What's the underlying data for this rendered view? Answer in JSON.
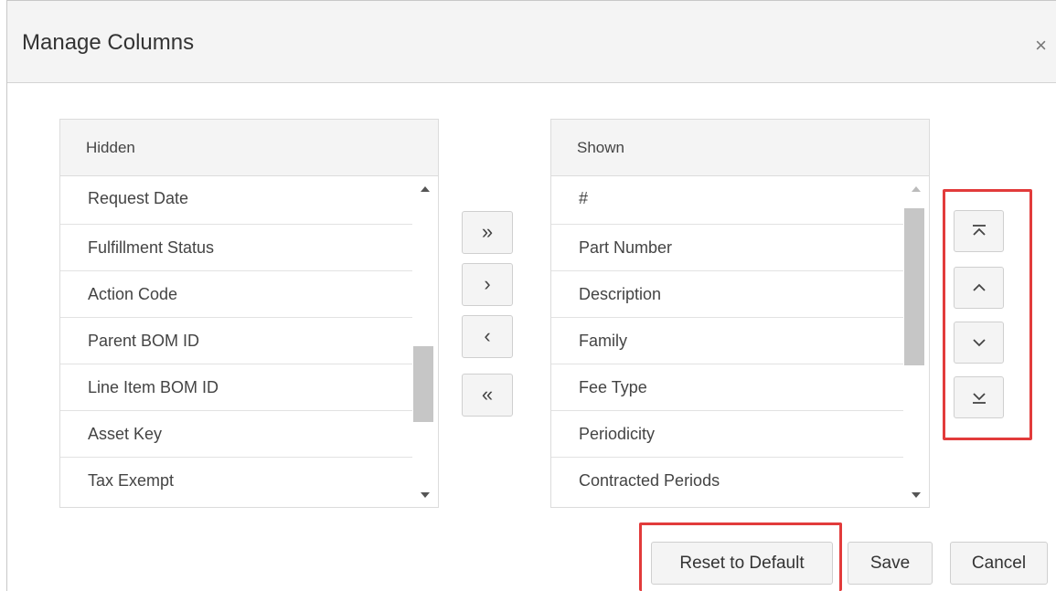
{
  "dialog": {
    "title": "Manage Columns",
    "close_glyph": "×"
  },
  "hidden": {
    "header": "Hidden",
    "items": [
      "Request Date",
      "Fulfillment Status",
      "Action Code",
      "Parent BOM ID",
      "Line Item BOM ID",
      "Asset Key",
      "Tax Exempt"
    ]
  },
  "shown": {
    "header": "Shown",
    "items": [
      "#",
      "Part Number",
      "Description",
      "Family",
      "Fee Type",
      "Periodicity",
      "Contracted Periods"
    ]
  },
  "transfer": {
    "move_all_right": "»",
    "move_right": "›",
    "move_left": "‹",
    "move_all_left": "«"
  },
  "reorder_icons": [
    "move-to-top-icon",
    "move-up-icon",
    "move-down-icon",
    "move-to-bottom-icon"
  ],
  "footer": {
    "reset": "Reset to Default",
    "save": "Save",
    "cancel": "Cancel"
  },
  "colors": {
    "highlight": "#e23b3b",
    "header_bg": "#f4f4f4"
  }
}
